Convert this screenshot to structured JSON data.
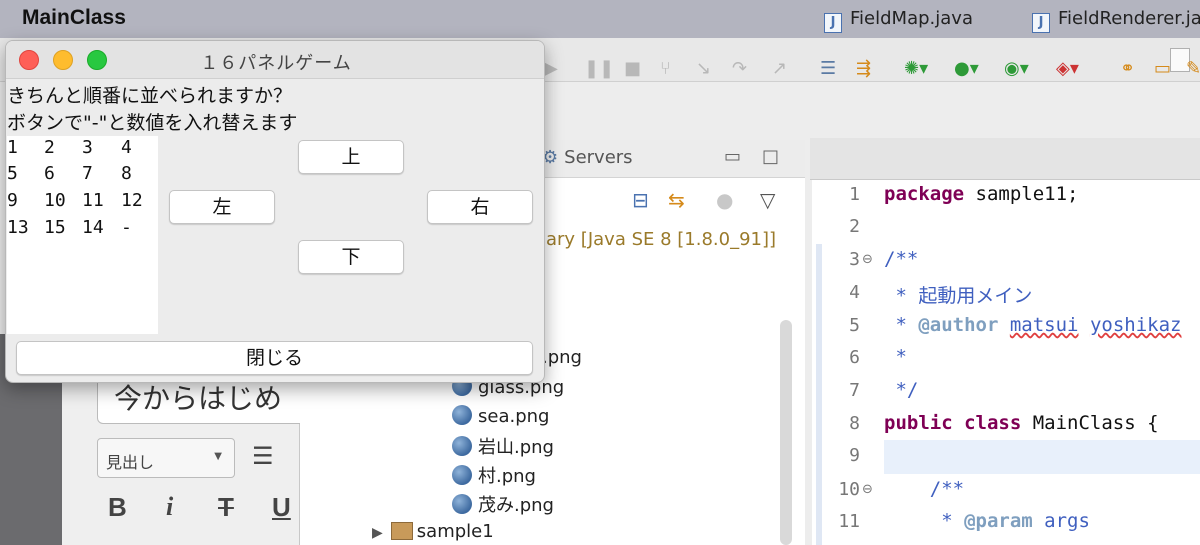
{
  "menubar": {
    "app_name": "MainClass"
  },
  "dialog": {
    "title": "１６パネルゲーム",
    "message_line1": "きちんと順番に並べられますか？",
    "message_line2": "ボタンで\"-\"と数値を入れ替えます",
    "grid": [
      [
        "1",
        "2",
        "3",
        "4"
      ],
      [
        "5",
        "6",
        "7",
        "8"
      ],
      [
        "9",
        "10",
        "11",
        "12"
      ],
      [
        "13",
        "15",
        "14",
        "-"
      ]
    ],
    "buttons": {
      "up": "上",
      "left": "左",
      "right": "右",
      "down": "下",
      "close": "閉じる"
    }
  },
  "blog_editor": {
    "title_text": "今からはじめ",
    "heading_select": "見出し",
    "format_buttons": [
      "B",
      "i",
      "T",
      "U"
    ]
  },
  "explorer": {
    "servers_tab": "Servers",
    "jre_label": "ary [Java SE 8 [1.8.0_91]]",
    "files": [
      ".png",
      "glass.png",
      "sea.png",
      "岩山.png",
      "村.png",
      "茂み.png"
    ],
    "project": "sample1"
  },
  "editor": {
    "tabs": [
      "FieldMap.java",
      "FieldRenderer.ja"
    ],
    "line_numbers": [
      "1",
      "2",
      "3",
      "4",
      "5",
      "6",
      "7",
      "8",
      "9",
      "10",
      "11"
    ],
    "lines": {
      "l1_kw": "package",
      "l1_rest": " sample11;",
      "l3": "/**",
      "l4": " * 起動用メイン",
      "l5_star": " * ",
      "l5_tag": "@author",
      "l5_name1": "matsui",
      "l5_name2": "yoshikaz",
      "l6": " *",
      "l7": " */",
      "l8_kw1": "public",
      "l8_kw2": "class",
      "l8_rest": " MainClass {",
      "l10": "    /**",
      "l11_star": "     * ",
      "l11_tag": "@param",
      "l11_rest": " args"
    }
  }
}
